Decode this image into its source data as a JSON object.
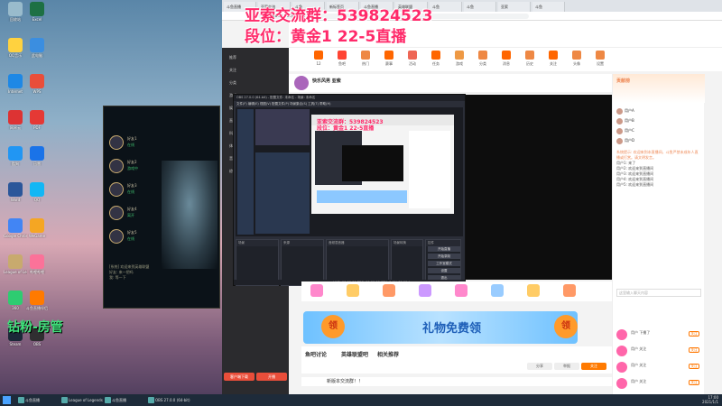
{
  "overlay": {
    "title": "亚索交流群：539824523",
    "subtitle": "段位：黄金1 22-5直播",
    "caption": "钻粉-房管"
  },
  "desktop_icons": [
    {
      "label": "回收站",
      "color": "#9bc"
    },
    {
      "label": "Excel",
      "color": "#1d7044"
    },
    {
      "label": "QQ音乐",
      "color": "#ffd23f"
    },
    {
      "label": "此电脑",
      "color": "#3b8ee0"
    },
    {
      "label": "Internet",
      "color": "#1e88e5"
    },
    {
      "label": "WPS",
      "color": "#e94e3a"
    },
    {
      "label": "网易云",
      "color": "#d33"
    },
    {
      "label": "PDF",
      "color": "#e53935"
    },
    {
      "label": "酷狗",
      "color": "#2196f3"
    },
    {
      "label": "迅雷",
      "color": "#1a73e8"
    },
    {
      "label": "Word",
      "color": "#2b579a"
    },
    {
      "label": "QQ",
      "color": "#12b7f5"
    },
    {
      "label": "Google Chrome",
      "color": "#4285f4"
    },
    {
      "label": "WeGame",
      "color": "#f5a623"
    },
    {
      "label": "League of Legends",
      "color": "#c8aa6e"
    },
    {
      "label": "哔哩哔哩",
      "color": "#fb7299"
    },
    {
      "label": "360",
      "color": "#2ecc71"
    },
    {
      "label": "斗鱼直播伴侣",
      "color": "#ff7a00"
    },
    {
      "label": "Steam",
      "color": "#1b2838"
    },
    {
      "label": "OBS",
      "color": "#302e31"
    }
  ],
  "lol": {
    "friends": [
      {
        "name": "好友1",
        "status": "在线"
      },
      {
        "name": "好友2",
        "status": "游戏中"
      },
      {
        "name": "好友3",
        "status": "在线"
      },
      {
        "name": "好友4",
        "status": "离开"
      },
      {
        "name": "好友5",
        "status": "在线"
      }
    ],
    "chat_lines": [
      "[系统] 欢迎来到英雄联盟",
      "好友: 来一把吗",
      "我: 等一下"
    ]
  },
  "browser": {
    "tabs": [
      "斗鱼直播",
      "亚索交流",
      "斗鱼",
      "新标签页",
      "斗鱼直播",
      "英雄联盟",
      "斗鱼",
      "斗鱼",
      "亚索",
      "斗鱼"
    ],
    "url": "https://www.douyu.com/"
  },
  "douyu": {
    "sidebar": [
      "推荐",
      "关注",
      "分类",
      "游戏",
      "娱乐",
      "直播",
      "科技",
      "体育",
      "音乐",
      "综合"
    ],
    "sidebar_buttons": [
      "客户端下载",
      "开播"
    ],
    "nav_items": [
      "12",
      "鱼吧",
      "热门",
      "赛事",
      "活动",
      "任务",
      "游戏",
      "分类",
      "消息",
      "历史",
      "关注",
      "头像",
      "设置"
    ],
    "room_title": "快乐风男 亚索",
    "chat_head_title": "贡献榜",
    "ranks": [
      {
        "name": "用户A"
      },
      {
        "name": "用户B"
      },
      {
        "name": "用户C"
      },
      {
        "name": "用户D"
      }
    ],
    "chat_messages": [
      {
        "text": "系统提示: 欢迎来到本直播间，斗鱼严禁未成年人直播或打赏。请文明发言。",
        "sys": true
      },
      {
        "text": "用户1: 来了"
      },
      {
        "text": "用户2: 欢迎来到直播间"
      },
      {
        "text": "用户3: 欢迎来到直播间"
      },
      {
        "text": "用户4: 欢迎来到直播间"
      },
      {
        "text": "用户5: 欢迎来到直播间"
      }
    ],
    "chat_input_placeholder": "这里输入聊天内容",
    "chat_users": [
      {
        "text": "用户 下播了"
      },
      {
        "text": "用户 关注"
      },
      {
        "text": "用户 关注"
      },
      {
        "text": "用户 关注"
      }
    ],
    "chat_follow_label": "关注",
    "banner_text": "礼物免费领",
    "banner_ling": "领",
    "page_tabs": [
      "鱼吧讨论",
      "英雄联盟吧",
      "相关推荐"
    ],
    "page_buttons": [
      "分享",
      "举报",
      "关注"
    ],
    "notice": "新版本交流群！！"
  },
  "obs": {
    "title": "OBS 27.0.0 (64-bit) - 配置文件: 未命名 - 场景: 未命名",
    "menu": "文件(F)  编辑(E)  视图(V)  配置文件(P)  场景集合(S)  工具(T)  帮助(H)",
    "panels": [
      "场景",
      "来源",
      "音频混音器",
      "场景转换",
      "控件"
    ],
    "controls": [
      "开始直播",
      "开始录制",
      "工作室模式",
      "设置",
      "退出"
    ],
    "status": "LIVE: 00:00:00  REC: 00:00:00  CPU: 5.0%  30.00 fps"
  },
  "taskbar": {
    "apps": [
      "斗鱼直播",
      "League of Legends",
      "斗鱼直播",
      "OBS 27.0.0 (64-bit)"
    ],
    "time": "17:00",
    "date": "2021/1/1"
  }
}
